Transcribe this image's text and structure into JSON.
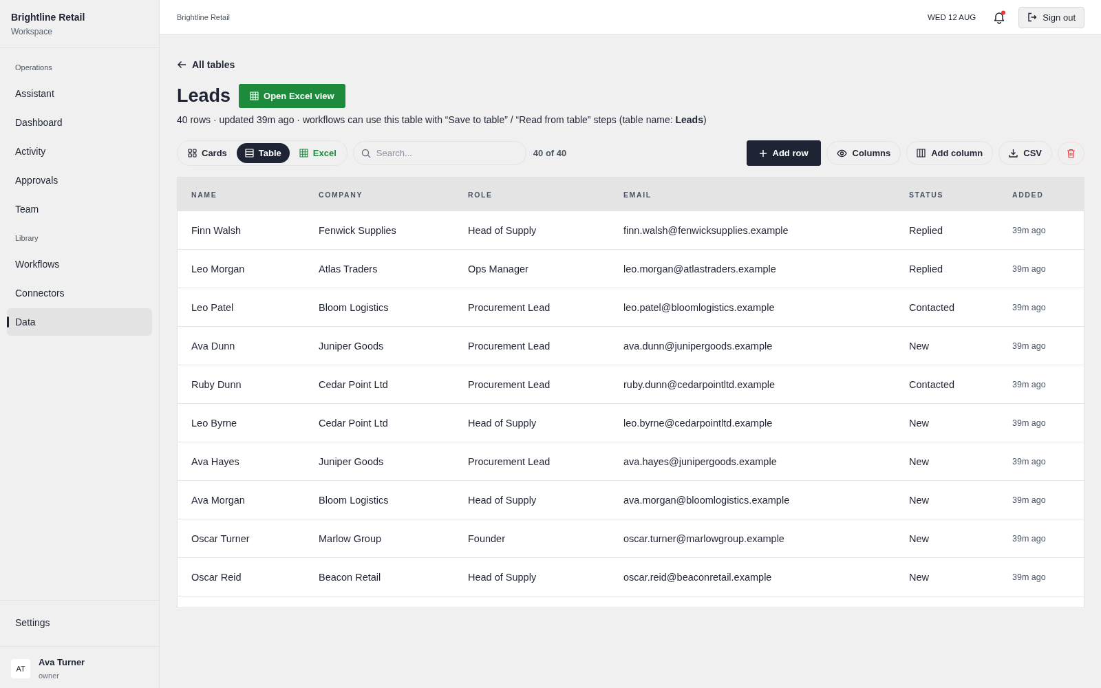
{
  "sidebar": {
    "brand": "Brightline Retail",
    "subtitle": "Workspace",
    "sections": [
      {
        "title": "Operations",
        "items": [
          {
            "label": "Assistant",
            "selected": false
          },
          {
            "label": "Dashboard",
            "selected": false
          },
          {
            "label": "Activity",
            "selected": false
          },
          {
            "label": "Approvals",
            "selected": false
          },
          {
            "label": "Team",
            "selected": false
          }
        ]
      },
      {
        "title": "Library",
        "items": [
          {
            "label": "Workflows",
            "selected": false
          },
          {
            "label": "Connectors",
            "selected": false
          },
          {
            "label": "Data",
            "selected": true
          }
        ]
      }
    ],
    "settings": "Settings",
    "user": {
      "initials": "AT",
      "name": "Ava Turner",
      "role": "owner"
    }
  },
  "topbar": {
    "breadcrumb": "Brightline Retail",
    "date": "WED 12 AUG",
    "notification_unread": true,
    "sign_out": "Sign out"
  },
  "back_link": "All tables",
  "title": "Leads",
  "open_excel": "Open Excel view",
  "description": "40 rows · updated 39m ago · workflows can use this table with “Save to table” / “Read from table” steps (table name: **Leads**)",
  "views": [
    {
      "kind": "cards",
      "label": "Cards",
      "selected": false
    },
    {
      "kind": "table",
      "label": "Table",
      "selected": true
    },
    {
      "kind": "excel",
      "label": "Excel",
      "selected": false
    }
  ],
  "search": {
    "placeholder": "Search..."
  },
  "count": "40 of 40",
  "actions": [
    {
      "kind": "add",
      "label": "Add row"
    },
    {
      "kind": "columns",
      "label": "Columns"
    },
    {
      "kind": "add-column",
      "label": "Add column"
    },
    {
      "kind": "csv",
      "label": "CSV"
    },
    {
      "kind": "delete"
    }
  ],
  "table": {
    "columns": [
      "NAME",
      "COMPANY",
      "ROLE",
      "EMAIL",
      "STATUS",
      "ADDED"
    ],
    "rows": [
      [
        "Finn Walsh",
        "Fenwick Supplies",
        "Head of Supply",
        "finn.walsh@fenwicksupplies.example",
        "Replied",
        "39m ago"
      ],
      [
        "Leo Morgan",
        "Atlas Traders",
        "Ops Manager",
        "leo.morgan@atlastraders.example",
        "Replied",
        "39m ago"
      ],
      [
        "Leo Patel",
        "Bloom Logistics",
        "Procurement Lead",
        "leo.patel@bloomlogistics.example",
        "Contacted",
        "39m ago"
      ],
      [
        "Ava Dunn",
        "Juniper Goods",
        "Procurement Lead",
        "ava.dunn@junipergoods.example",
        "New",
        "39m ago"
      ],
      [
        "Ruby Dunn",
        "Cedar Point Ltd",
        "Procurement Lead",
        "ruby.dunn@cedarpointltd.example",
        "Contacted",
        "39m ago"
      ],
      [
        "Leo Byrne",
        "Cedar Point Ltd",
        "Head of Supply",
        "leo.byrne@cedarpointltd.example",
        "New",
        "39m ago"
      ],
      [
        "Ava Hayes",
        "Juniper Goods",
        "Procurement Lead",
        "ava.hayes@junipergoods.example",
        "New",
        "39m ago"
      ],
      [
        "Ava Morgan",
        "Bloom Logistics",
        "Head of Supply",
        "ava.morgan@bloomlogistics.example",
        "New",
        "39m ago"
      ],
      [
        "Oscar Turner",
        "Marlow Group",
        "Founder",
        "oscar.turner@marlowgroup.example",
        "New",
        "39m ago"
      ],
      [
        "Oscar Reid",
        "Beacon Retail",
        "Head of Supply",
        "oscar.reid@beaconretail.example",
        "New",
        "39m ago"
      ]
    ]
  }
}
